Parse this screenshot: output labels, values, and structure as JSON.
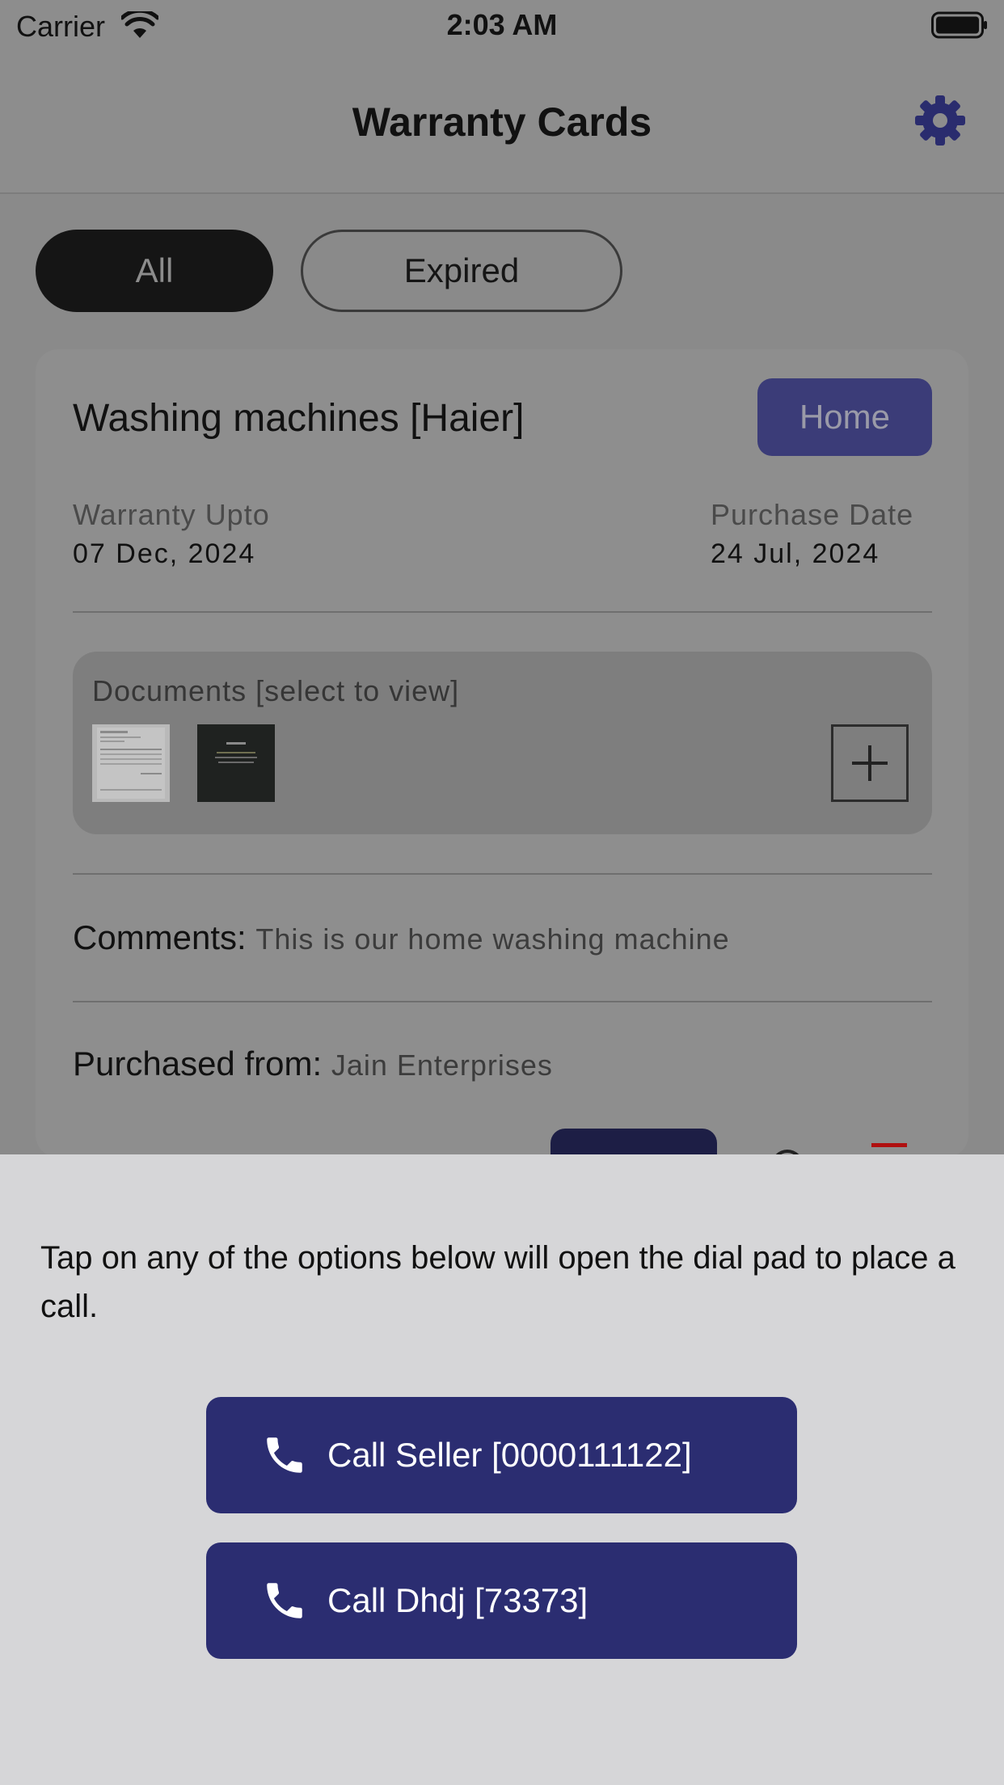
{
  "status_bar": {
    "carrier": "Carrier",
    "time": "2:03 AM",
    "icons": [
      "wifi-icon",
      "battery-icon"
    ]
  },
  "nav": {
    "title": "Warranty Cards",
    "settings_icon": "gear-icon",
    "accent_color": "#2b2d71"
  },
  "tabs": [
    {
      "label": "All",
      "selected": true
    },
    {
      "label": "Expired",
      "selected": false
    }
  ],
  "card": {
    "title": "Washing machines [Haier]",
    "tag": "Home",
    "warranty_label": "Warranty Upto",
    "warranty_value": "07 Dec, 2024",
    "purchase_label": "Purchase Date",
    "purchase_value": "24 Jul, 2024",
    "documents_label": "Documents [select to view]",
    "documents_count": 2,
    "add_icon": "plus-icon",
    "comments_label": "Comments:",
    "comments_value": "This is our home washing machine",
    "purchased_label": "Purchased from:",
    "purchased_value": "Jain Enterprises"
  },
  "sheet": {
    "message": "Tap on any of the options below will open the dial pad to place a call.",
    "buttons": [
      {
        "label": "Call Seller [0000111122]",
        "icon": "phone-icon"
      },
      {
        "label": "Call Dhdj [73373]",
        "icon": "phone-icon"
      }
    ]
  }
}
